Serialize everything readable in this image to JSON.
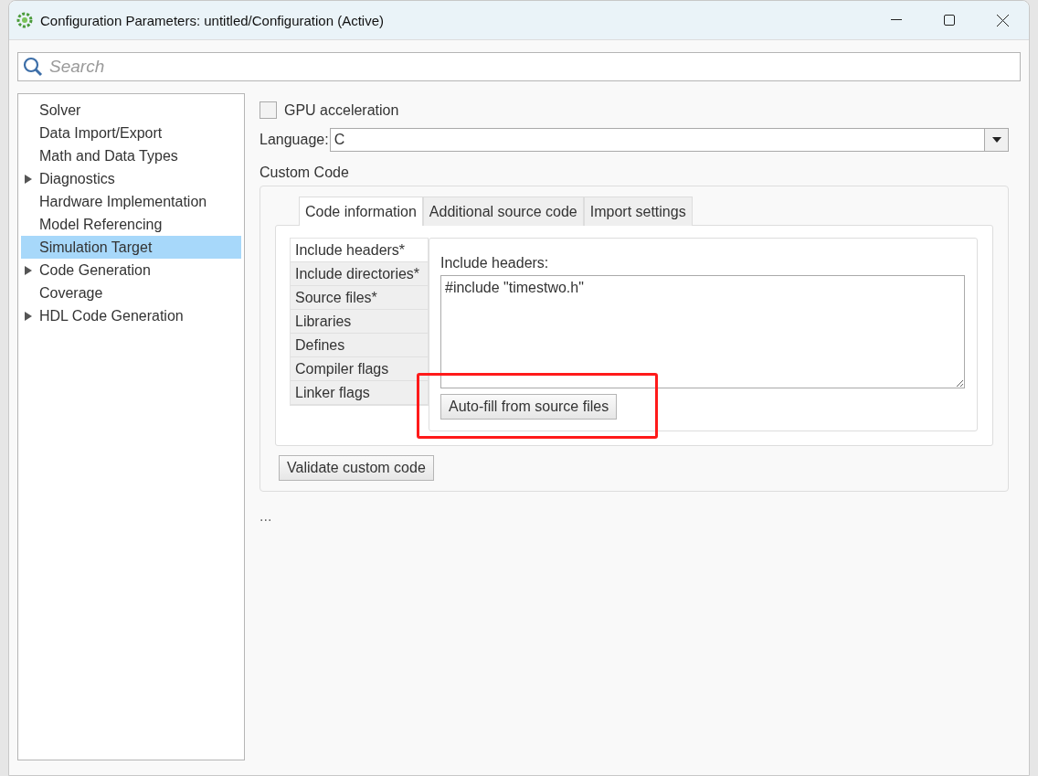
{
  "window": {
    "title": "Configuration Parameters: untitled/Configuration (Active)"
  },
  "search": {
    "placeholder": "Search"
  },
  "sidebar": {
    "items": [
      {
        "label": "Solver",
        "expandable": false,
        "selected": false
      },
      {
        "label": "Data Import/Export",
        "expandable": false,
        "selected": false
      },
      {
        "label": "Math and Data Types",
        "expandable": false,
        "selected": false
      },
      {
        "label": "Diagnostics",
        "expandable": true,
        "selected": false
      },
      {
        "label": "Hardware Implementation",
        "expandable": false,
        "selected": false
      },
      {
        "label": "Model Referencing",
        "expandable": false,
        "selected": false
      },
      {
        "label": "Simulation Target",
        "expandable": false,
        "selected": true
      },
      {
        "label": "Code Generation",
        "expandable": true,
        "selected": false
      },
      {
        "label": "Coverage",
        "expandable": false,
        "selected": false
      },
      {
        "label": "HDL Code Generation",
        "expandable": true,
        "selected": false
      }
    ]
  },
  "gpu_acceleration": {
    "label": "GPU acceleration",
    "checked": false
  },
  "language": {
    "label": "Language:",
    "value": "C"
  },
  "custom_code": {
    "title": "Custom Code",
    "tabs": [
      {
        "label": "Code information",
        "selected": true
      },
      {
        "label": "Additional source code",
        "selected": false
      },
      {
        "label": "Import settings",
        "selected": false
      }
    ],
    "sections": [
      {
        "label": "Include headers*",
        "selected": true
      },
      {
        "label": "Include directories*",
        "selected": false
      },
      {
        "label": "Source files*",
        "selected": false
      },
      {
        "label": "Libraries",
        "selected": false
      },
      {
        "label": "Defines",
        "selected": false
      },
      {
        "label": "Compiler flags",
        "selected": false
      },
      {
        "label": "Linker flags",
        "selected": false
      }
    ],
    "field_label": "Include headers:",
    "field_value": "#include \"timestwo.h\"",
    "autofill_button": "Auto-fill from source files",
    "highlighted": true,
    "validate_button": "Validate custom code"
  },
  "more": "..."
}
